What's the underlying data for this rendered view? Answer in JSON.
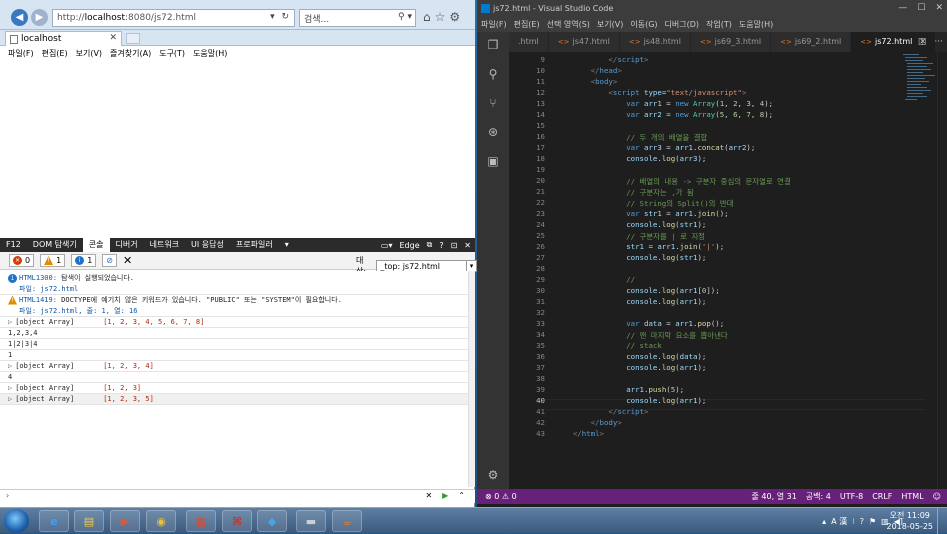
{
  "ie": {
    "address": "http://localhost:8080/js72.html",
    "address_prefix": "http://",
    "address_host": "localhost",
    "address_rest": ":8080/js72.html",
    "search_placeholder": "검색...",
    "tab_title": "localhost",
    "menu": [
      "파일(F)",
      "편집(E)",
      "보기(V)",
      "즐겨찾기(A)",
      "도구(T)",
      "도움말(H)"
    ]
  },
  "devtools": {
    "tabs": [
      "F12",
      "DOM 탐색기",
      "콘솔",
      "디버거",
      "네트워크",
      "UI 응답성",
      "프로파일러",
      "▾"
    ],
    "active_tab": "콘솔",
    "emulation": "Edge",
    "errors_count": "0",
    "warnings_count": "1",
    "info_count": "1",
    "target_label": "대상:",
    "target_value": "_top: js72.html",
    "messages": [
      {
        "type": "info",
        "code": "HTML1300:",
        "text": " 탐색이 실행되었습니다.",
        "sub": "파일: js72.html"
      },
      {
        "type": "warn",
        "code": "HTML1419:",
        "text": " DOCTYPE에 예기치 않은 키워드가 있습니다. \"PUBLIC\" 또는 \"SYSTEM\"이 필요합니다.",
        "sub": "파일: js72.html, 줄: 1, 열: 16"
      }
    ],
    "logs": [
      {
        "kind": "array",
        "label": "[object Array]",
        "value": "[1, 2, 3, 4, 5, 6, 7, 8]"
      },
      {
        "kind": "text",
        "value": "1,2,3,4"
      },
      {
        "kind": "text",
        "value": "1|2|3|4"
      },
      {
        "kind": "text",
        "value": "1"
      },
      {
        "kind": "array",
        "label": "[object Array]",
        "value": "[1, 2, 3, 4]"
      },
      {
        "kind": "text",
        "value": "4"
      },
      {
        "kind": "array",
        "label": "[object Array]",
        "value": "[1, 2, 3]"
      },
      {
        "kind": "array",
        "label": "[object Array]",
        "value": "[1, 2, 3, 5]"
      }
    ]
  },
  "vscode": {
    "title": "js72.html - Visual Studio Code",
    "menu": [
      "파일(F)",
      "편집(E)",
      "선택 영역(S)",
      "보기(V)",
      "이동(G)",
      "디버그(D)",
      "작업(T)",
      "도움말(H)"
    ],
    "tabs": [
      ".html",
      "js47.html",
      "js48.html",
      "js69_3.html",
      "js69_2.html",
      "js72.html"
    ],
    "active_tab": "js72.html",
    "status": {
      "errors": "0",
      "warnings": "0",
      "position": "줄 40, 열 31",
      "spaces": "공백: 4",
      "encoding": "UTF-8",
      "eol": "CRLF",
      "language": "HTML"
    }
  },
  "taskbar": {
    "ime": "A 漢",
    "time": "오전 11:09",
    "date": "2018-05-25"
  }
}
